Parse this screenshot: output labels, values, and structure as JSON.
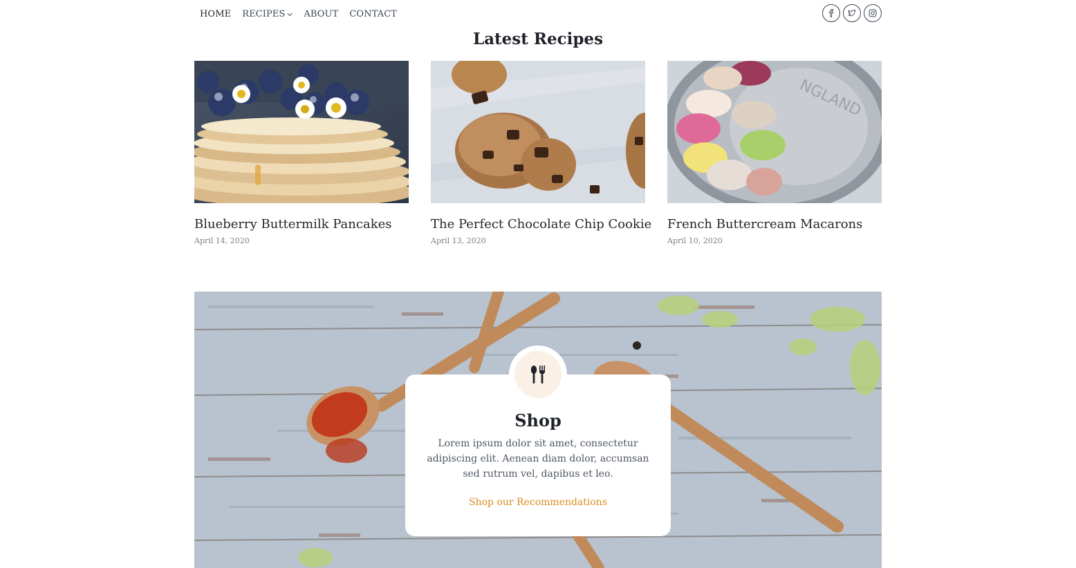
{
  "nav": {
    "items": [
      {
        "label": "HOME",
        "active": true
      },
      {
        "label": "RECIPES",
        "has_dropdown": true
      },
      {
        "label": "ABOUT"
      },
      {
        "label": "CONTACT"
      }
    ],
    "socials": [
      "facebook-icon",
      "twitter-icon",
      "instagram-icon"
    ]
  },
  "latest": {
    "title": "Latest Recipes",
    "recipes": [
      {
        "title": "Blueberry Buttermilk Pancakes",
        "date": "April 14, 2020",
        "image": "pancakes-photo"
      },
      {
        "title": "The Perfect Chocolate Chip Cookie",
        "date": "April 13, 2020",
        "image": "cookies-photo"
      },
      {
        "title": "French Buttercream Macarons",
        "date": "April 10, 2020",
        "image": "macarons-photo"
      }
    ]
  },
  "shop": {
    "icon": "utensils-icon",
    "title": "Shop",
    "text": "Lorem ipsum dolor sit amet, consectetur adipiscing elit. Aenean diam dolor, accumsan sed rutrum vel, dapibus et leo.",
    "link": "Shop our Recommendations"
  },
  "colors": {
    "accent": "#d98b1f",
    "text": "#1f2329",
    "muted": "#7a818a",
    "icon_bg": "#fbf0e6"
  }
}
